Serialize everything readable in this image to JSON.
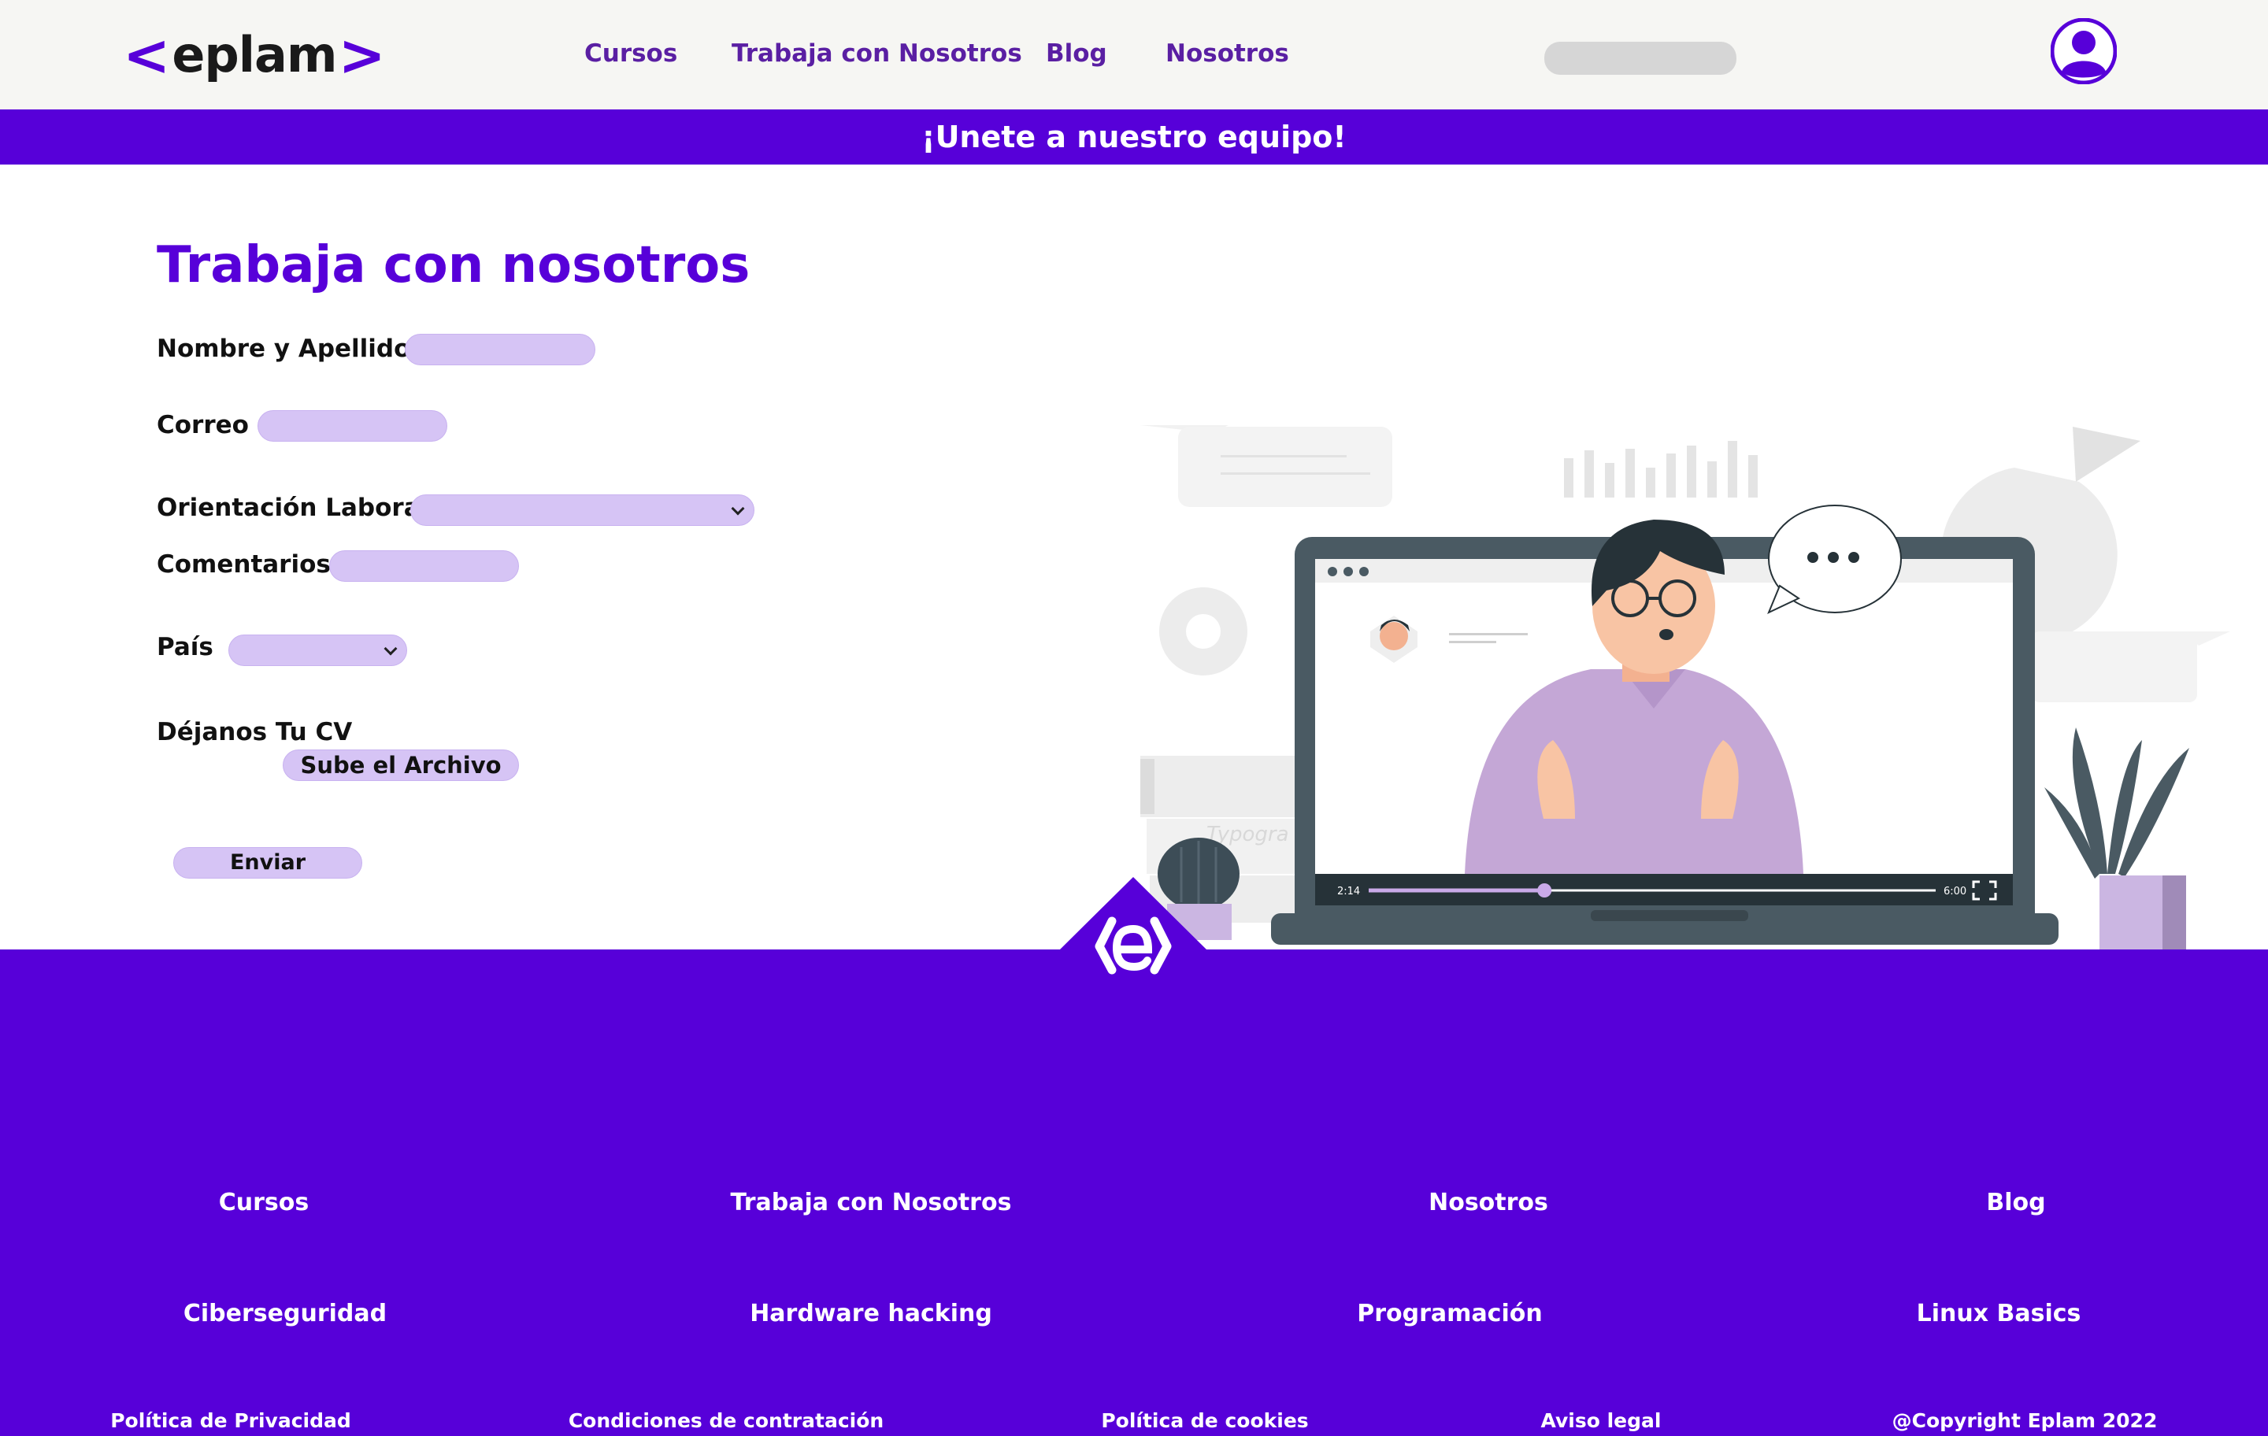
{
  "header": {
    "logo": {
      "left_bracket": "<",
      "word": "eplam",
      "right_bracket": ">"
    },
    "nav": [
      "Cursos",
      "Trabaja con Nosotros",
      "Blog",
      "Nosotros"
    ],
    "search_placeholder": "",
    "avatar_icon": "user-circle-icon"
  },
  "banner": {
    "text": "¡Unete a nuestro equipo!"
  },
  "form": {
    "title": "Trabaja con nosotros",
    "name_label": "Nombre y Apellidos",
    "email_label": "Correo",
    "orientation_label": "Orientación Laboral",
    "comments_label": "Comentarios",
    "country_label": "País",
    "cv_label": "Déjanos Tu CV",
    "upload_label": "Sube el Archivo",
    "submit_label": "Enviar"
  },
  "illustration": {
    "video_time_current": "2:14",
    "video_time_total": "6:00",
    "video_progress": 0.31,
    "bg_text": "Typogra"
  },
  "footer": {
    "row1": [
      "Cursos",
      "Trabaja con Nosotros",
      "Nosotros",
      "Blog"
    ],
    "row2": [
      "Ciberseguridad",
      "Hardware hacking",
      "Programación",
      "Linux Basics"
    ],
    "row3": [
      "Política de Privacidad",
      "Condiciones de contratación",
      "Política de cookies",
      "Aviso legal",
      "@Copyright Eplam 2022"
    ]
  },
  "colors": {
    "brand": "#5700d9",
    "nav_text": "#5a1fa3",
    "input_fill": "#d6c4f5",
    "header_bg": "#f6f6f3"
  }
}
